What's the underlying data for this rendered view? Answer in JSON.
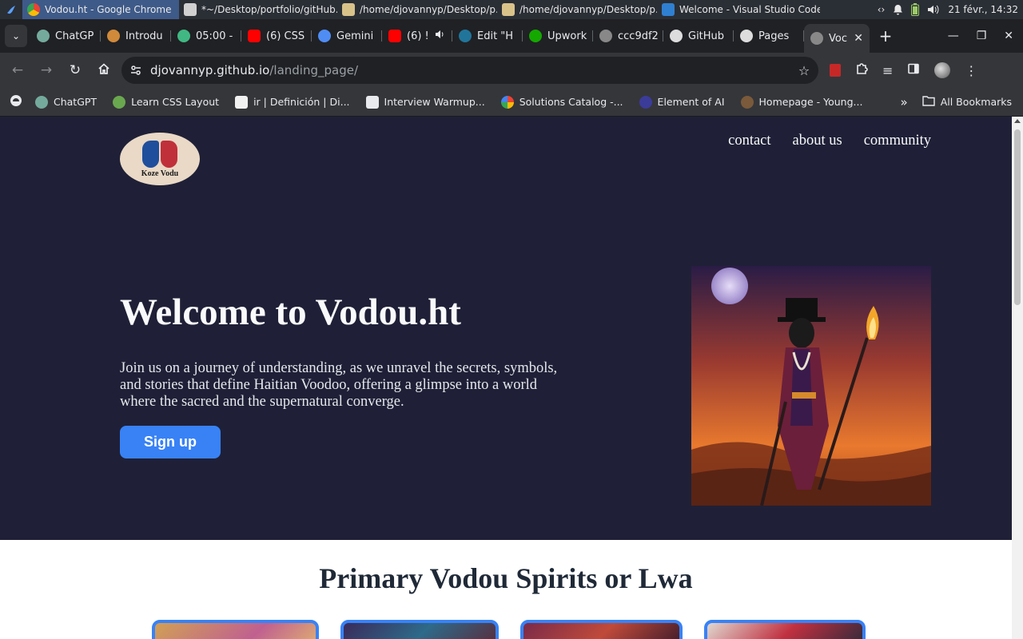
{
  "taskbar": {
    "items": [
      {
        "label": "Vodou.ht - Google Chrome",
        "icon": "chrome-icon"
      },
      {
        "label": "*~/Desktop/portfolio/gitHub...",
        "icon": "text-editor-icon"
      },
      {
        "label": "/home/djovannyp/Desktop/p...",
        "icon": "folder-icon"
      },
      {
        "label": "/home/djovannyp/Desktop/p...",
        "icon": "folder-icon"
      },
      {
        "label": "Welcome - Visual Studio Code",
        "icon": "vscode-icon"
      }
    ],
    "clock": "21 févr., 14:32"
  },
  "tabs": [
    {
      "label": "ChatGP",
      "icon": "chatgpt-icon",
      "color": "#74aa9c"
    },
    {
      "label": "Introdu",
      "icon": "fox-icon",
      "color": "#d08a3a"
    },
    {
      "label": "05:00 -",
      "icon": "check-circle-icon",
      "color": "#41b883"
    },
    {
      "label": "(6) CSS",
      "icon": "youtube-icon",
      "color": "#ff0000"
    },
    {
      "label": "Gemini",
      "icon": "gemini-icon",
      "color": "#4f8df5"
    },
    {
      "label": "(6) !",
      "icon": "youtube-icon",
      "color": "#ff0000"
    },
    {
      "label": "Edit \"H",
      "icon": "wordpress-icon",
      "color": "#21759b"
    },
    {
      "label": "Upwork",
      "icon": "upwork-icon",
      "color": "#14a800"
    },
    {
      "label": "ccc9df2",
      "icon": "globe-icon",
      "color": "#888888"
    },
    {
      "label": "GitHub",
      "icon": "github-icon",
      "color": "#dddddd"
    },
    {
      "label": "Pages",
      "icon": "github-icon",
      "color": "#dddddd"
    },
    {
      "label": "Voc",
      "icon": "loading-icon",
      "color": "#888888",
      "active": true
    }
  ],
  "omnibox": {
    "host": "djovannyp.github.io",
    "path": "/landing_page/"
  },
  "bookmarks": [
    {
      "label": "ChatGPT",
      "icon": "chatgpt-icon",
      "color": "#74aa9c"
    },
    {
      "label": "Learn CSS Layout",
      "icon": "css-icon",
      "color": "#6aa84f"
    },
    {
      "label": "ir | Definición | Di...",
      "icon": "dictionary-icon",
      "color": "#f1f1f1"
    },
    {
      "label": "Interview Warmup...",
      "icon": "interview-icon",
      "color": "#e8eaed"
    },
    {
      "label": "Solutions Catalog -...",
      "icon": "google-icon",
      "color": "#4285f4"
    },
    {
      "label": "Element of AI",
      "icon": "ai-icon",
      "color": "#3b3b9a"
    },
    {
      "label": "Homepage - Young...",
      "icon": "person-icon",
      "color": "#7a5a3a"
    }
  ],
  "bookmarks_all": "All Bookmarks",
  "page": {
    "logo_text": "Koze Vodu",
    "nav": [
      "contact",
      "about us",
      "community"
    ],
    "hero_title": "Welcome to Vodou.ht",
    "hero_text": "Join us on a journey of understanding, as we unravel the secrets, symbols, and stories that define Haitian Voodoo, offering a glimpse into a world where the sacred and the supernatural converge.",
    "signup_label": "Sign up",
    "section_title": "Primary Vodou Spirits or Lwa"
  }
}
